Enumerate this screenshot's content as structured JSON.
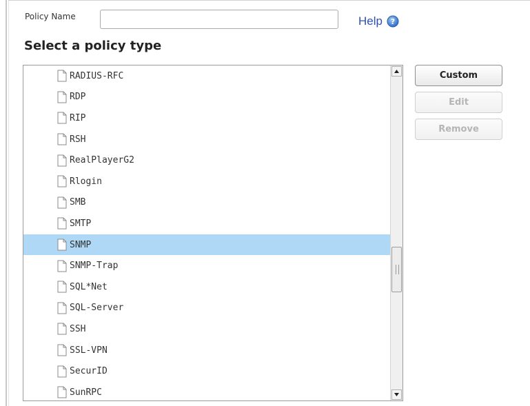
{
  "form": {
    "policy_name_label": "Policy Name",
    "policy_name_value": "",
    "help_label": "Help",
    "section_title": "Select a policy type"
  },
  "policy_types": [
    {
      "label": "RADIUS-RFC",
      "selected": false
    },
    {
      "label": "RDP",
      "selected": false
    },
    {
      "label": "RIP",
      "selected": false
    },
    {
      "label": "RSH",
      "selected": false
    },
    {
      "label": "RealPlayerG2",
      "selected": false
    },
    {
      "label": "Rlogin",
      "selected": false
    },
    {
      "label": "SMB",
      "selected": false
    },
    {
      "label": "SMTP",
      "selected": false
    },
    {
      "label": "SNMP",
      "selected": true
    },
    {
      "label": "SNMP-Trap",
      "selected": false
    },
    {
      "label": "SQL*Net",
      "selected": false
    },
    {
      "label": "SQL-Server",
      "selected": false
    },
    {
      "label": "SSH",
      "selected": false
    },
    {
      "label": "SSL-VPN",
      "selected": false
    },
    {
      "label": "SecurID",
      "selected": false
    },
    {
      "label": "SunRPC",
      "selected": false
    }
  ],
  "buttons": {
    "custom_label": "Custom",
    "edit_label": "Edit",
    "remove_label": "Remove",
    "edit_enabled": false,
    "remove_enabled": false
  },
  "icons": {
    "help": "help-icon",
    "file": "file-icon",
    "scroll_up": "arrow-up-icon",
    "scroll_down": "arrow-down-icon"
  },
  "colors": {
    "selection": "#aed8f5",
    "help_link": "#2f4fb8",
    "disabled_text": "#b5b5b5"
  }
}
